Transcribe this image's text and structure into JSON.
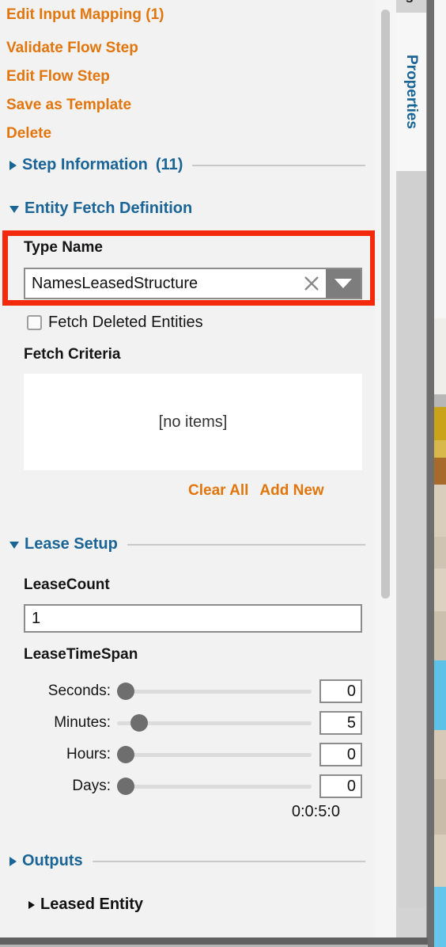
{
  "colors": {
    "action_orange": "#e2760d",
    "section_blue": "#1a6496",
    "highlight_red": "#f32a0c",
    "panel_bg": "#f2f2f2",
    "input_border": "#8c8c8c",
    "slider_thumb": "#6e6e6e",
    "dropdown_btn": "#7d7d7d"
  },
  "actions": [
    {
      "label": "Edit Input Mapping (1)"
    },
    {
      "label": "Validate Flow Step"
    },
    {
      "label": "Edit Flow Step"
    },
    {
      "label": "Save as Template"
    },
    {
      "label": "Delete"
    }
  ],
  "sections": {
    "step_information": {
      "title": "Step Information",
      "count": "(11)",
      "expanded": false,
      "triangle_icon": "triangle-right-icon"
    },
    "entity_fetch_definition": {
      "title": "Entity Fetch Definition",
      "expanded": true,
      "triangle_icon": "triangle-down-icon",
      "type_name": {
        "label": "Type Name",
        "value": "NamesLeasedStructure",
        "clear_icon": "close-x-icon",
        "dropdown_icon": "chevron-down-icon",
        "highlighted": true
      },
      "fetch_deleted": {
        "label": "Fetch Deleted Entities",
        "checked": false
      },
      "fetch_criteria": {
        "label": "Fetch Criteria",
        "empty_text": "[no items]",
        "items": [],
        "clear_all_label": "Clear All",
        "add_new_label": "Add New"
      }
    },
    "lease_setup": {
      "title": "Lease Setup",
      "expanded": true,
      "triangle_icon": "triangle-down-icon",
      "lease_count": {
        "label": "LeaseCount",
        "value": "1"
      },
      "lease_timespan": {
        "label": "LeaseTimeSpan",
        "sliders": [
          {
            "label": "Seconds:",
            "value": "0",
            "percent": 0
          },
          {
            "label": "Minutes:",
            "value": "5",
            "percent": 8
          },
          {
            "label": "Hours:",
            "value": "0",
            "percent": 0
          },
          {
            "label": "Days:",
            "value": "0",
            "percent": 0
          }
        ],
        "summary": "0:0:5:0"
      }
    },
    "outputs": {
      "title": "Outputs",
      "expanded": false,
      "triangle_icon": "triangle-right-icon",
      "items": [
        {
          "label": "Leased Entity",
          "triangle_icon": "triangle-right-icon"
        }
      ]
    }
  },
  "side_tab": {
    "label": "Properties",
    "partial_above": "s"
  },
  "scrollbar": {
    "name": "vertical-scrollbar"
  }
}
